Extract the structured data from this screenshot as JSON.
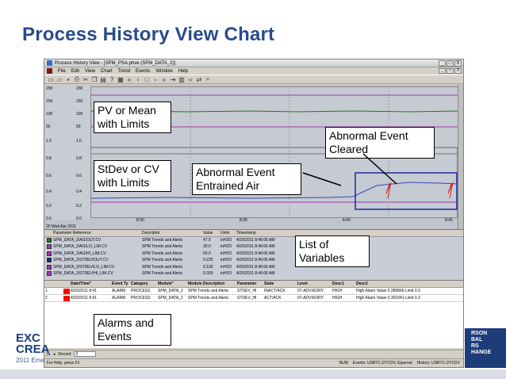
{
  "slide": {
    "title": "Process History View Chart"
  },
  "app": {
    "title": "Process History View - [SPM_PSA.phve (SPM_DATA_2)]",
    "menu": [
      "File",
      "Edit",
      "View",
      "Chart",
      "Trend",
      "Events",
      "Window",
      "Help"
    ],
    "window_buttons": [
      "_",
      "□",
      "X"
    ]
  },
  "trend": {
    "y_labels": [
      {
        "t": "200",
        "row": 0
      },
      {
        "t": "150",
        "row": 1
      },
      {
        "t": "100",
        "row": 2
      },
      {
        "t": "50",
        "row": 3
      },
      {
        "t": "1.0",
        "row": 4
      },
      {
        "t": "0.8",
        "row": 5
      },
      {
        "t": "0.6",
        "row": 6
      },
      {
        "t": "0.4",
        "row": 7
      },
      {
        "t": "0.2",
        "row": 8
      },
      {
        "t": "0.0",
        "row": 9
      }
    ],
    "x_labels": [
      "8:30",
      "8:35",
      "8:40",
      "8:45"
    ],
    "date": "20 Wed Apr 2011"
  },
  "parameters": {
    "headers": [
      "Parameter Reference",
      "Descriptor",
      "Value",
      "Units",
      "Timestamp"
    ],
    "rows": [
      {
        "color": "#1f7a1f",
        "name": "SPM_DATA_2/AI1/OUT.CV",
        "desc": "SPM Trends and Alerts",
        "value": "47.5",
        "units": "inH2O",
        "ts": "4/20/2011 8:46:06 AM"
      },
      {
        "color": "#9a3aa8",
        "name": "SPM_DATA_2/AI1/LO_LIM.CV",
        "desc": "SPM Trends and Alerts",
        "value": "30.0",
        "units": "inH2O",
        "ts": "4/20/2011 8:46:06 AM"
      },
      {
        "color": "#9a3aa8",
        "name": "SPM_DATA_2/AI1/HI_LIM.CV",
        "desc": "SPM Trends and Alerts",
        "value": "60.0",
        "units": "inH2O",
        "ts": "4/20/2011 8:46:06 AM"
      },
      {
        "color": "#1a237e",
        "name": "SPM_DATA_2/STDEV/OUT.CV",
        "desc": "SPM Trends and Alerts",
        "value": "0.225",
        "units": "inH2O",
        "ts": "4/20/2011 8:46:06 AM"
      },
      {
        "color": "#9a3aa8",
        "name": "SPM_DATA_2/STDEV/LO_LIM.CV",
        "desc": "SPM Trends and Alerts",
        "value": "0.100",
        "units": "inH2O",
        "ts": "4/20/2011 8:46:06 AM"
      },
      {
        "color": "#9a3aa8",
        "name": "SPM_DATA_2/STDEV/HI_LIM.CV",
        "desc": "SPM Trends and Alerts",
        "value": "0.300",
        "units": "inH2O",
        "ts": "4/20/2011 8:46:06 AM"
      }
    ]
  },
  "alarms": {
    "headers": [
      "",
      "",
      "Date/Time*",
      "Event Ty",
      "Category",
      "Module*",
      "Module Description",
      "Parameter",
      "State",
      "Level",
      "Desc1",
      "Desc2"
    ],
    "rows": [
      {
        "idx": "1",
        "date": "4/20/2011 8:41",
        "evt": "ALARM",
        "cat": "PROCESS",
        "mod": "SPM_DATA_2",
        "mdesc": "SPM Trends and Alerts",
        "par": "STDEV_HI",
        "state": "INACT/ACK",
        "lvl": "07-ADVISORY",
        "d1": "HIGH",
        "d2": "High Alarm Value 0.289866 Limit 0.3"
      },
      {
        "idx": "2",
        "date": "4/20/2011 8:41",
        "evt": "ALARM",
        "cat": "PROCESS",
        "mod": "SPM_DATA_2",
        "mdesc": "SPM Trends and Alerts",
        "par": "STDEV_HI",
        "state": "ACT/ACK",
        "lvl": "07-ADVISORY",
        "d1": "HIGH",
        "d2": "High Alarm Value 0.301041 Limit 0.3"
      }
    ]
  },
  "record_bar": {
    "label": "Record",
    "value": "0"
  },
  "status": {
    "left": "For Help, press F1",
    "num": "NUM",
    "events": "Events: USRTC-DTCDV, Ejournal",
    "history": "History: USRTC-DTCDV"
  },
  "callouts": {
    "pv": "PV or Mean with Limits",
    "stdev": "StDev or CV with Limits",
    "entrained": "Abnormal Event Entrained Air",
    "cleared": "Abnormal Event Cleared",
    "variables": "List of Variables",
    "alarms": "Alarms and Events"
  },
  "brand": {
    "left_lines": [
      "EXC",
      "CREA"
    ],
    "left_year": "2011 Eme",
    "right_lines": [
      "RSON",
      "BAL",
      "RS",
      "HANGE"
    ]
  },
  "icons": [
    "new-icon",
    "open-icon",
    "save-icon",
    "print-icon",
    "back-icon",
    "forward-icon"
  ]
}
